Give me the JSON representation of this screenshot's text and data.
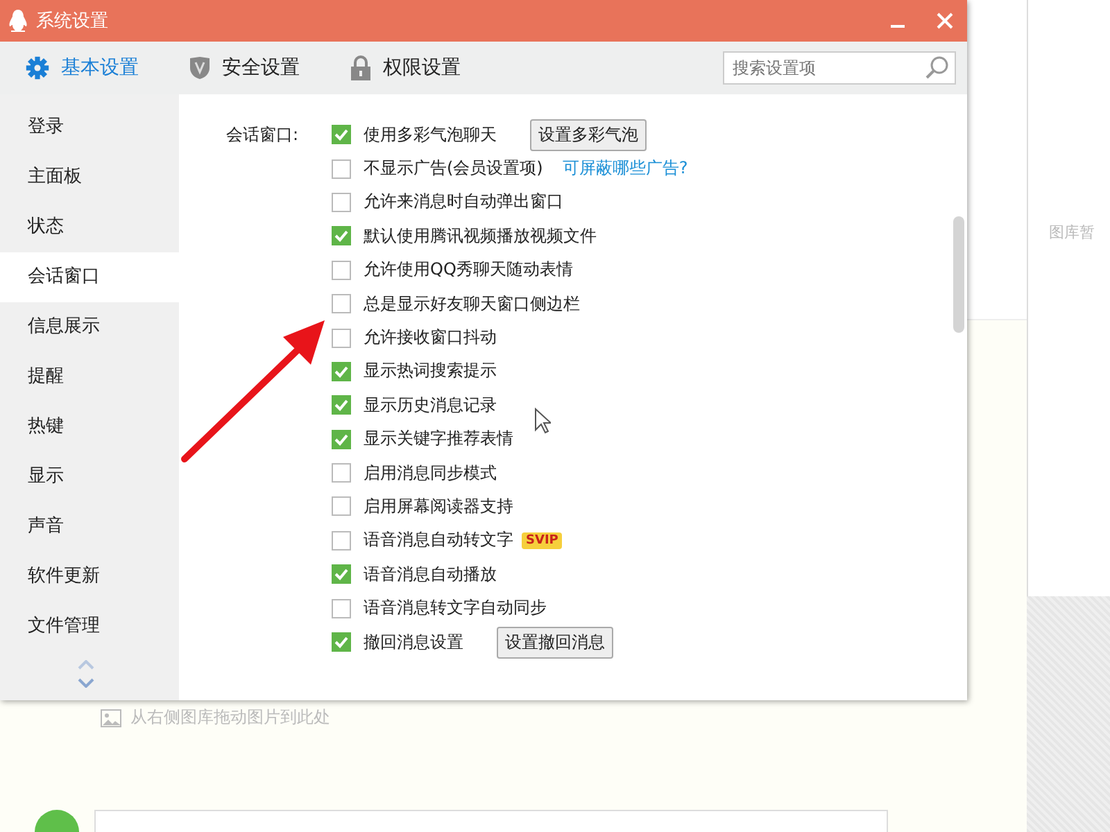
{
  "background": {
    "gallery_note": "图库暂",
    "drop_hint": "从右侧图库拖动图片到此处"
  },
  "window": {
    "title": "系统设置"
  },
  "tabs": [
    {
      "label": "基本设置",
      "selected": true
    },
    {
      "label": "安全设置",
      "selected": false
    },
    {
      "label": "权限设置",
      "selected": false
    }
  ],
  "search": {
    "placeholder": "搜索设置项"
  },
  "sidebar": {
    "items": [
      {
        "label": "登录",
        "selected": false
      },
      {
        "label": "主面板",
        "selected": false
      },
      {
        "label": "状态",
        "selected": false
      },
      {
        "label": "会话窗口",
        "selected": true
      },
      {
        "label": "信息展示",
        "selected": false
      },
      {
        "label": "提醒",
        "selected": false
      },
      {
        "label": "热键",
        "selected": false
      },
      {
        "label": "显示",
        "selected": false
      },
      {
        "label": "声音",
        "selected": false
      },
      {
        "label": "软件更新",
        "selected": false
      },
      {
        "label": "文件管理",
        "selected": false
      }
    ]
  },
  "section": {
    "label": "会话窗口:",
    "options": [
      {
        "label": "使用多彩气泡聊天",
        "checked": true,
        "button": "设置多彩气泡"
      },
      {
        "label": "不显示广告(会员设置项)",
        "checked": false,
        "link": "可屏蔽哪些广告?"
      },
      {
        "label": "允许来消息时自动弹出窗口",
        "checked": false
      },
      {
        "label": "默认使用腾讯视频播放视频文件",
        "checked": true
      },
      {
        "label": "允许使用QQ秀聊天随动表情",
        "checked": false
      },
      {
        "label": "总是显示好友聊天窗口侧边栏",
        "checked": false
      },
      {
        "label": "允许接收窗口抖动",
        "checked": false
      },
      {
        "label": "显示热词搜索提示",
        "checked": true
      },
      {
        "label": "显示历史消息记录",
        "checked": true
      },
      {
        "label": "显示关键字推荐表情",
        "checked": true
      },
      {
        "label": "启用消息同步模式",
        "checked": false
      },
      {
        "label": "启用屏幕阅读器支持",
        "checked": false
      },
      {
        "label": "语音消息自动转文字",
        "checked": false,
        "badge": "SVIP"
      },
      {
        "label": "语音消息自动播放",
        "checked": true
      },
      {
        "label": "语音消息转文字自动同步",
        "checked": false
      },
      {
        "label": "撤回消息设置",
        "checked": true,
        "button": "设置撤回消息"
      }
    ]
  }
}
